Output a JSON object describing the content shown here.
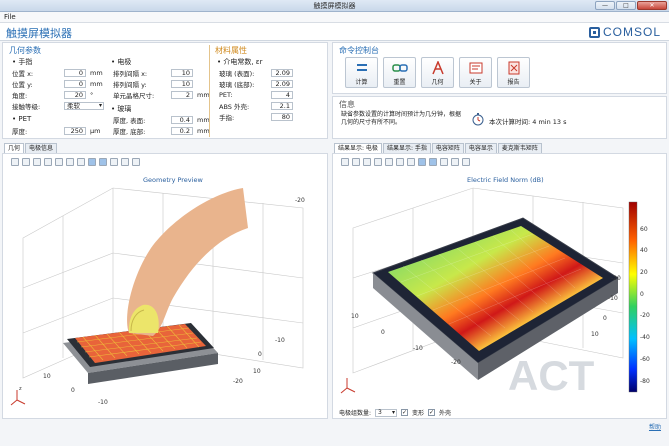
{
  "window": {
    "title": "触摸屏模拟器",
    "minimize": "—",
    "maximize": "□",
    "close": "✕"
  },
  "menu": {
    "file": "File"
  },
  "app": {
    "title": "触摸屏模拟器",
    "brand": "COMSOL"
  },
  "geometry": {
    "title": "几何参数",
    "finger": {
      "title": "• 手指",
      "rows": [
        {
          "label": "位置 x:",
          "value": "0",
          "unit": "mm"
        },
        {
          "label": "位置 y:",
          "value": "0",
          "unit": "mm"
        },
        {
          "label": "角度:",
          "value": "20",
          "unit": "°"
        }
      ],
      "contact_label": "接触等级:",
      "contact_value": "柔软"
    },
    "pet": {
      "title": "• PET",
      "label": "厚度:",
      "value": "250",
      "unit": "µm"
    }
  },
  "electrode": {
    "title": "• 电极",
    "rows": [
      {
        "label": "排列间隔 x:",
        "value": "10",
        "unit": ""
      },
      {
        "label": "排列间隔 y:",
        "value": "10",
        "unit": ""
      },
      {
        "label": "单元晶格尺寸:",
        "value": "2",
        "unit": "mm"
      }
    ],
    "glass_title": "• 玻璃",
    "glass_rows": [
      {
        "label": "厚度, 表面:",
        "value": "0.4",
        "unit": "mm"
      },
      {
        "label": "厚度, 底部:",
        "value": "0.2",
        "unit": "mm"
      }
    ]
  },
  "material": {
    "title": "材料属性",
    "sub": "• 介电常数, εr",
    "rows": [
      {
        "label": "玻璃 (表面):",
        "value": "2.09"
      },
      {
        "label": "玻璃 (底部):",
        "value": "2.09"
      },
      {
        "label": "PET:",
        "value": "4"
      },
      {
        "label": "ABS 外壳:",
        "value": "2.1"
      },
      {
        "label": "手指:",
        "value": "80"
      }
    ]
  },
  "command": {
    "title": "命令控制台",
    "buttons": [
      {
        "label": "计算"
      },
      {
        "label": "重置"
      },
      {
        "label": "几何"
      },
      {
        "label": "关于"
      },
      {
        "label": "报告"
      }
    ]
  },
  "info": {
    "title": "信息",
    "text": "缺省参数设置的计算时间预计为几分钟，根据几何的尺寸有所不同。",
    "time_text": "本次计算时间: 4 min 13 s"
  },
  "left_view": {
    "tabs": [
      "几何",
      "电极信息"
    ],
    "plot_title": "Geometry Preview",
    "ticks": [
      "10",
      "0",
      "-10",
      "-20",
      "10",
      "0",
      "-10",
      "-20"
    ]
  },
  "right_view": {
    "tabs": [
      "结果显示: 电极",
      "结果显示: 手指",
      "电容矩阵",
      "电容显示",
      "麦克斯韦矩阵"
    ],
    "plot_title": "Electric Field Norm (dB)",
    "ticks": [
      "10",
      "0",
      "-10",
      "-20",
      "10",
      "0",
      "-10",
      "-20"
    ],
    "colorbar": {
      "ticks": [
        "60",
        "40",
        "20",
        "0",
        "-20",
        "-40",
        "-60",
        "-80"
      ],
      "colors": [
        "#c00000",
        "#ff8000",
        "#ffff00",
        "#30d060",
        "#00c0ff",
        "#0040ff",
        "#000080"
      ]
    },
    "footer": {
      "label": "电极组数量:",
      "value": "3",
      "chk1": "变形",
      "chk2": "外壳"
    },
    "watermark": "ACT"
  },
  "status": {
    "help": "帮助"
  }
}
